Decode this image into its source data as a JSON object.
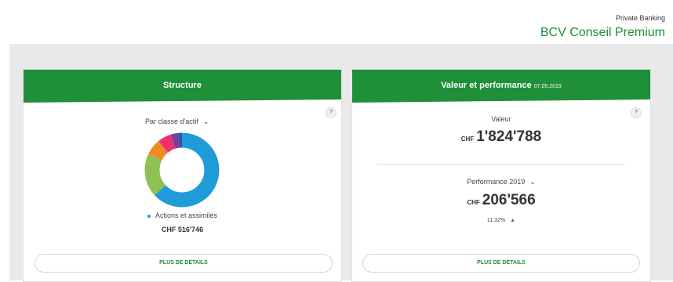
{
  "brand": {
    "subtitle": "Private Banking",
    "title": "BCV Conseil Premium"
  },
  "colors": {
    "brand_green": "#1f8f3a",
    "accent_blue": "#1e9bd8"
  },
  "structure": {
    "title": "Structure",
    "help": "?",
    "selector_label": "Par classe d'actif",
    "selector_icon": "chevron-down-icon",
    "legend_label": "Actions et assimilés",
    "legend_value": "CHF 516'746",
    "details_label": "PLUS DE DÉTAILS",
    "chart_data": {
      "type": "pie",
      "donut": true,
      "slices": [
        {
          "color": "#1e9bd8",
          "value": 63
        },
        {
          "color": "#8dc152",
          "value": 19
        },
        {
          "color": "#f08a24",
          "value": 7
        },
        {
          "color": "#e8346b",
          "value": 6
        },
        {
          "color": "#7d3d9b",
          "value": 3
        },
        {
          "color": "#2a5ba8",
          "value": 2
        }
      ]
    }
  },
  "performance": {
    "title": "Valeur et performance",
    "date": "07.05.2019",
    "help": "?",
    "value_label": "Valeur",
    "value_currency": "CHF",
    "value_amount": "1'824'788",
    "perf_label": "Performance 2019",
    "perf_icon": "chevron-down-icon",
    "perf_currency": "CHF",
    "perf_amount": "206'566",
    "perf_pct": "11.32%",
    "perf_trend_icon": "triangle-up-icon",
    "details_label": "PLUS DE DÉTAILS"
  }
}
